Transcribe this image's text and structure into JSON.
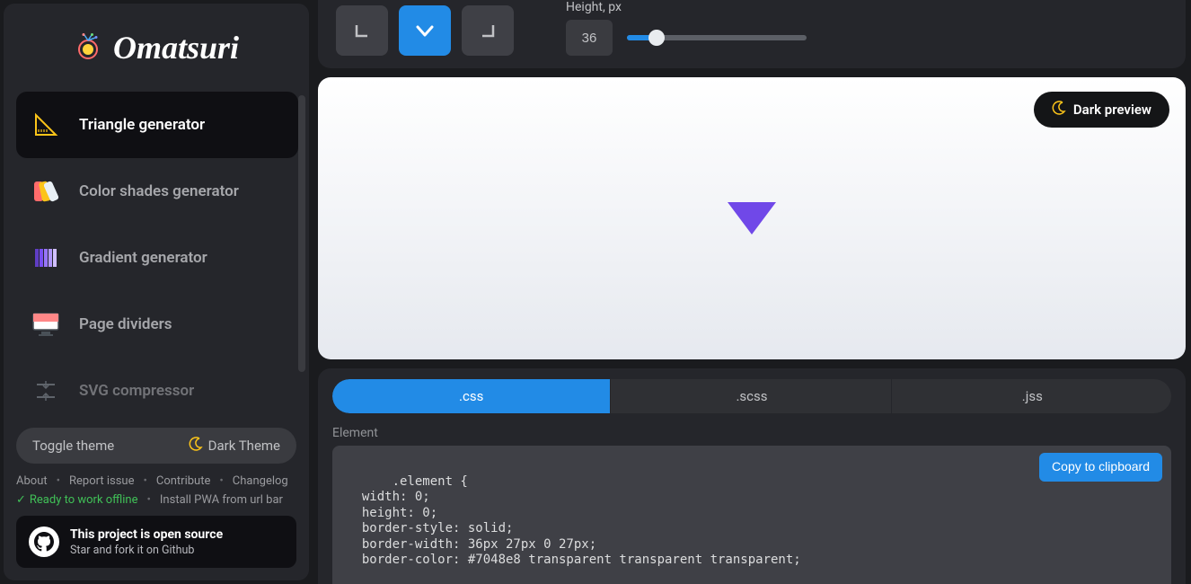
{
  "brand": {
    "name": "Omatsuri"
  },
  "sidebar": {
    "items": [
      {
        "label": "Triangle generator",
        "active": true
      },
      {
        "label": "Color shades generator",
        "active": false
      },
      {
        "label": "Gradient generator",
        "active": false
      },
      {
        "label": "Page dividers",
        "active": false
      },
      {
        "label": "SVG compressor",
        "active": false
      }
    ]
  },
  "theme_toggle": {
    "label": "Toggle theme",
    "current": "Dark Theme"
  },
  "footer_links": {
    "about": "About",
    "report": "Report issue",
    "contribute": "Contribute",
    "changelog": "Changelog",
    "offline": "Ready to work offline",
    "pwa": "Install PWA from url bar"
  },
  "github": {
    "title": "This project is open source",
    "subtitle": "Star and fork it on Github"
  },
  "toolbar": {
    "height_label": "Height, px",
    "height_value": "36"
  },
  "preview": {
    "dark_btn": "Dark preview",
    "triangle_color": "#7048e8"
  },
  "code_tabs": {
    "css": ".css",
    "scss": ".scss",
    "jss": ".jss"
  },
  "element_label": "Element",
  "copy_label": "Copy to clipboard",
  "code_lines": {
    "l1": ".element {",
    "l2": "  width: 0;",
    "l3": "  height: 0;",
    "l4": "  border-style: solid;",
    "l5": "  border-width: 36px 27px 0 27px;",
    "l6": "  border-color: #7048e8 transparent transparent transparent;"
  }
}
